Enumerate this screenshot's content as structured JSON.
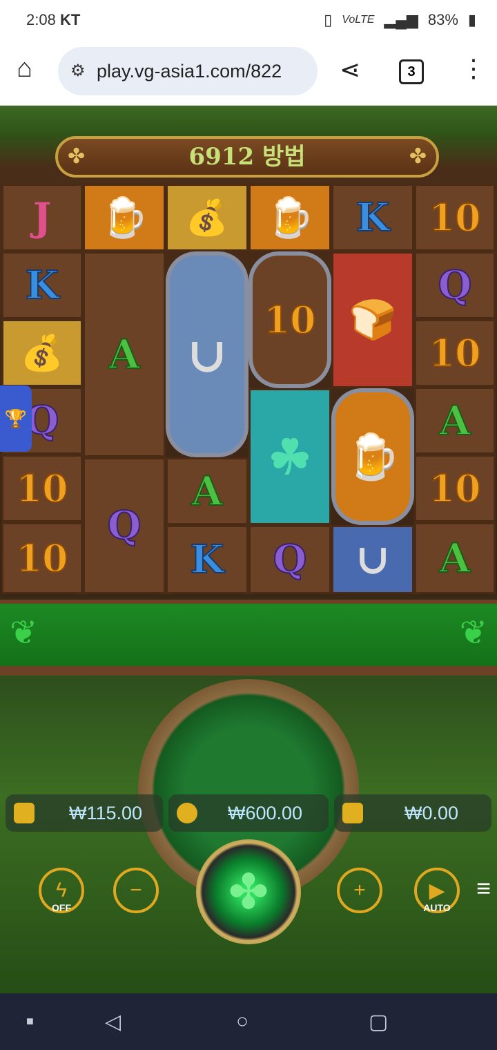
{
  "status": {
    "time": "2:08",
    "carrier": "KT",
    "battery": "83%"
  },
  "browser": {
    "url": "play.vg-asia1.com/822",
    "tabs": "3"
  },
  "game": {
    "ways_label": "6912 방법",
    "balance": "₩115.00",
    "bet": "₩600.00",
    "win": "₩0.00",
    "turbo_label": "OFF",
    "auto_label": "AUTO",
    "grid": [
      [
        "J",
        "mug",
        "chest",
        "mug",
        "K",
        "10"
      ],
      [
        "K",
        "A",
        "horseshoe",
        "10",
        "bread",
        "Q"
      ],
      [
        "chest",
        "A",
        "horseshoe",
        "10",
        "bread",
        "10"
      ],
      [
        "Q",
        "A",
        "horseshoe",
        "clover",
        "mug",
        "A"
      ],
      [
        "10",
        "Q",
        "A",
        "clover",
        "mug",
        "10"
      ],
      [
        "10",
        "Q",
        "K",
        "Q",
        "horseshoe",
        "A"
      ]
    ]
  },
  "colors": {
    "accent": "#e0a820",
    "reel_wood": "#6b4226",
    "banner_green": "#1d8a24"
  }
}
